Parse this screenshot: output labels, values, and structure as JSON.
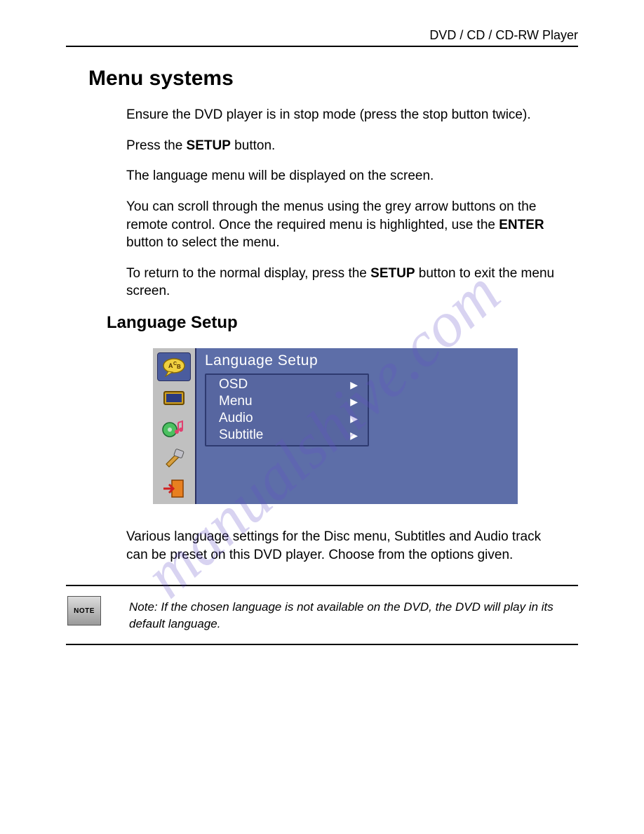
{
  "header": {
    "title": "DVD / CD / CD-RW Player"
  },
  "section": {
    "title": "Menu systems"
  },
  "paragraphs": {
    "p1": "Ensure the DVD player is in stop mode (press the stop button twice).",
    "p2a": "Press the ",
    "p2b": "SETUP",
    "p2c": " button.",
    "p3": "The language menu will be displayed on the screen.",
    "p4a": "You can scroll through the menus using the grey arrow buttons on the remote control. Once the required menu is highlighted, use the ",
    "p4b": "ENTER",
    "p4c": " button to select the menu.",
    "p5a": "To return to the normal display, press the ",
    "p5b": "SETUP",
    "p5c": " button to exit the menu screen."
  },
  "subsection": {
    "title": "Language Setup"
  },
  "osd": {
    "title": "Language  Setup",
    "items": [
      "OSD",
      "Menu",
      "Audio",
      "Subtitle"
    ],
    "sidebar_icons": [
      "language-icon",
      "screen-icon",
      "audio-icon",
      "tools-icon",
      "exit-icon"
    ],
    "selected_sidebar_index": 0
  },
  "after_osd": "Various language settings for the Disc menu, Subtitles and Audio track can be preset on this DVD player. Choose from the options given.",
  "note": {
    "badge": "NOTE",
    "text": "Note: If the chosen language is not available on the DVD, the DVD will play in its default language."
  },
  "watermark": "manualshive.com"
}
